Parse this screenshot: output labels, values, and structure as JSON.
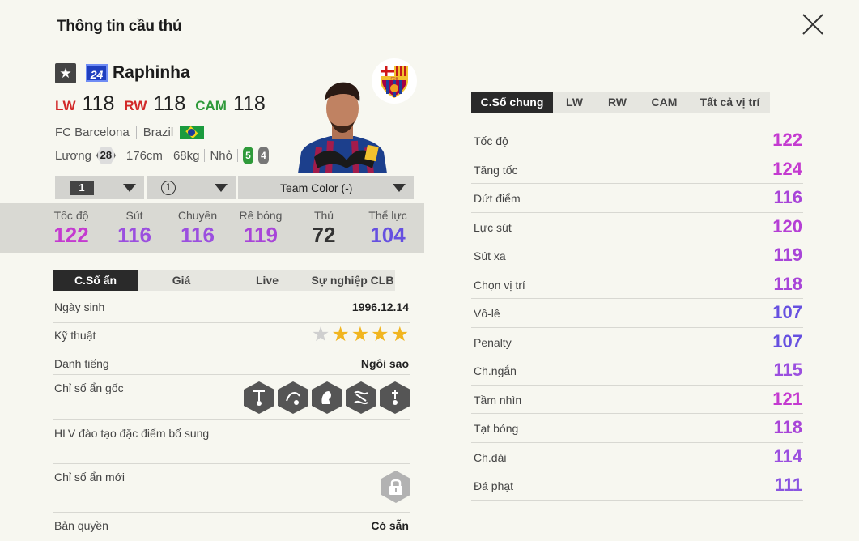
{
  "window": {
    "title": "Thông tin cầu thủ",
    "close_icon": "close-icon"
  },
  "player": {
    "season_number": "24",
    "name": "Raphinha",
    "positions": [
      {
        "label": "LW",
        "value": "118",
        "color": "#d22828"
      },
      {
        "label": "RW",
        "value": "118",
        "color": "#d22828"
      },
      {
        "label": "CAM",
        "value": "118",
        "color": "#2f9a3a"
      }
    ],
    "club": "FC Barcelona",
    "nation": "Brazil",
    "salary_label": "Lương",
    "salary": "28",
    "height": "176cm",
    "weight": "68kg",
    "body_type": "Nhỏ",
    "foot_left": "5",
    "foot_right": "4",
    "club_logo_text": "FCB"
  },
  "selectors": {
    "level": "1",
    "ovr_boost": "1",
    "team_color": "Team Color (-)"
  },
  "main_stats": [
    {
      "label": "Tốc độ",
      "value": "122",
      "color": "#c43bd0"
    },
    {
      "label": "Sút",
      "value": "116",
      "color": "#9b4fdf"
    },
    {
      "label": "Chuyền",
      "value": "116",
      "color": "#9b4fdf"
    },
    {
      "label": "Rê bóng",
      "value": "119",
      "color": "#a845d8"
    },
    {
      "label": "Thủ",
      "value": "72",
      "color": "#333333"
    },
    {
      "label": "Thể lực",
      "value": "104",
      "color": "#6650e0"
    }
  ],
  "left_tabs": [
    "C.Số ẩn",
    "Giá",
    "Live",
    "Sự nghiệp CLB"
  ],
  "details": {
    "birth_label": "Ngày sinh",
    "birth": "1996.12.14",
    "skill_label": "Kỹ thuật",
    "skill_stars": 4,
    "skill_max": 5,
    "fame_label": "Danh tiếng",
    "fame": "Ngôi sao",
    "traits_label": "Chỉ số ẩn gốc",
    "coach_label": "HLV đào tạo đặc điểm bổ sung",
    "new_traits_label": "Chỉ số ẩn mới",
    "license_label": "Bản quyền",
    "license": "Có sẵn"
  },
  "right_tabs": [
    "C.Số chung",
    "LW",
    "RW",
    "CAM",
    "Tất cả vị trí"
  ],
  "detail_stats": [
    {
      "label": "Tốc độ",
      "value": "122",
      "color": "#c43bd0"
    },
    {
      "label": "Tăng tốc",
      "value": "124",
      "color": "#c43bd0"
    },
    {
      "label": "Dứt điểm",
      "value": "116",
      "color": "#a845d8"
    },
    {
      "label": "Lực sút",
      "value": "120",
      "color": "#b53fd5"
    },
    {
      "label": "Sút xa",
      "value": "119",
      "color": "#a845d8"
    },
    {
      "label": "Chọn vị trí",
      "value": "118",
      "color": "#a845d8"
    },
    {
      "label": "Vô-lê",
      "value": "107",
      "color": "#6650e0"
    },
    {
      "label": "Penalty",
      "value": "107",
      "color": "#6650e0"
    },
    {
      "label": "Ch.ngắn",
      "value": "115",
      "color": "#9b4fdf"
    },
    {
      "label": "Tầm nhìn",
      "value": "121",
      "color": "#c43bd0"
    },
    {
      "label": "Tạt bóng",
      "value": "118",
      "color": "#a845d8"
    },
    {
      "label": "Ch.dài",
      "value": "114",
      "color": "#9b4fdf"
    },
    {
      "label": "Đá phạt",
      "value": "111",
      "color": "#8a55e0"
    }
  ]
}
